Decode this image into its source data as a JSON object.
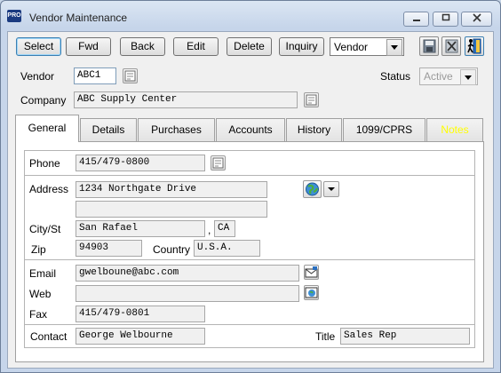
{
  "window": {
    "app_icon_text": "PRO",
    "title": "Vendor Maintenance"
  },
  "toolbar": {
    "select_label": "Select",
    "fwd_label": "Fwd",
    "back_label": "Back",
    "edit_label": "Edit",
    "delete_label": "Delete",
    "inquiry_label": "Inquiry",
    "mode_value": "Vendor"
  },
  "header": {
    "vendor_label": "Vendor",
    "vendor_value": "ABC1",
    "status_label": "Status",
    "status_value": "Active",
    "company_label": "Company",
    "company_value": "ABC Supply Center"
  },
  "tabs": [
    {
      "label": "General"
    },
    {
      "label": "Details"
    },
    {
      "label": "Purchases"
    },
    {
      "label": "Accounts"
    },
    {
      "label": "History"
    },
    {
      "label": "1099/CPRS"
    },
    {
      "label": "Notes"
    }
  ],
  "general": {
    "phone_label": "Phone",
    "phone_value": "415/479-0800",
    "address_label": "Address",
    "address1_value": "1234 Northgate Drive",
    "address2_value": "",
    "city_label": "City/St",
    "city_value": "San Rafael",
    "state_separator": ",",
    "state_value": "CA",
    "zip_label": "Zip",
    "zip_value": "94903",
    "country_label": "Country",
    "country_value": "U.S.A.",
    "email_label": "Email",
    "email_value": "gwelboune@abc.com",
    "web_label": "Web",
    "web_value": "",
    "fax_label": "Fax",
    "fax_value": "415/479-0801",
    "contact_label": "Contact",
    "contact_value": "George Welbourne",
    "title_label": "Title",
    "title_value": "Sales Rep"
  },
  "colors": {
    "notes_tab_text": "#ffff00",
    "status_text": "#9a9a9a"
  },
  "icons": [
    "minimize-icon",
    "maximize-icon",
    "close-icon",
    "dropdown-arrow-icon",
    "save-icon",
    "cancel-icon",
    "exit-icon",
    "lookup-icon",
    "globe-icon",
    "email-icon",
    "web-link-icon"
  ]
}
